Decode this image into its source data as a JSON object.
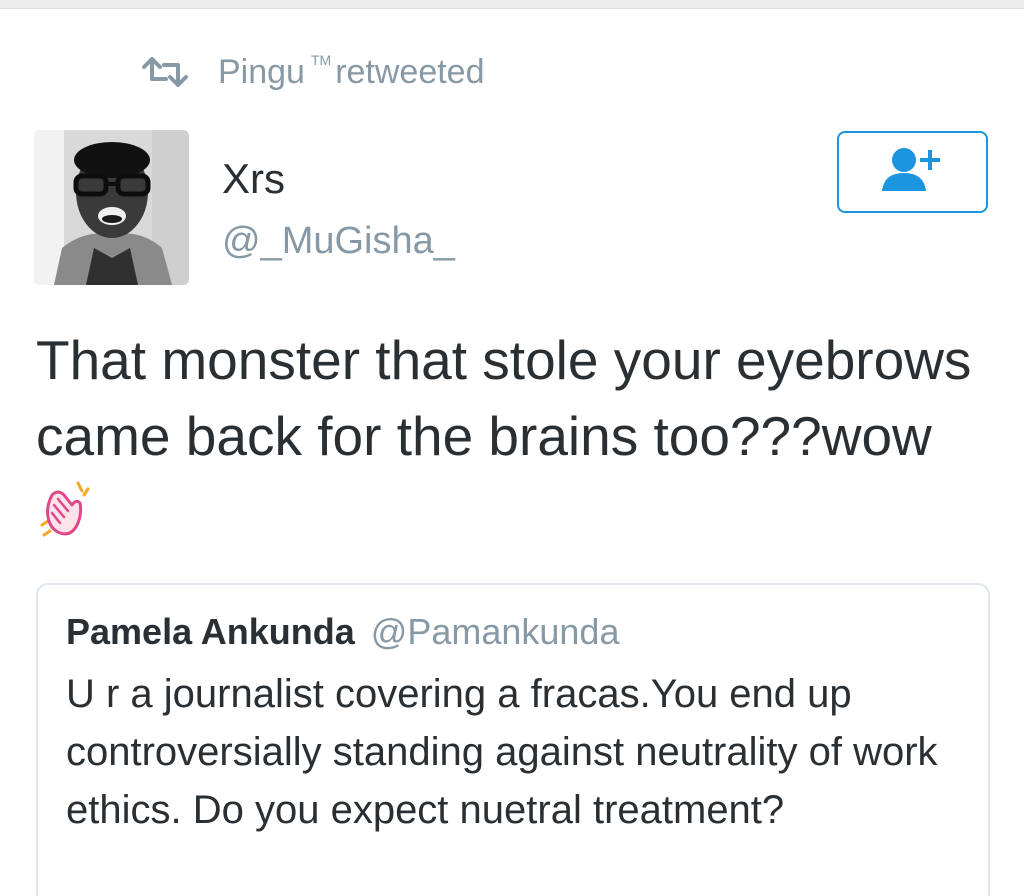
{
  "context": {
    "retweeter_name": "Pingu",
    "trademark": "TM",
    "action": "retweeted",
    "icon": "retweet-icon"
  },
  "tweet": {
    "user_name": "Xrs",
    "user_handle": "@_MuGisha_",
    "avatar": "user-avatar",
    "follow_icon": "follow-user-plus-icon",
    "text": "That monster that stole your eyebrows came back for the brains too???wow",
    "emoji": "clapping-hands-emoji"
  },
  "quote": {
    "name": "Pamela Ankunda",
    "handle": "@Pamankunda",
    "text": "U r a journalist covering a fracas.You end up controversially standing against neutrality of work ethics. Do you expect nuetral treatment?"
  },
  "colors": {
    "accent": "#1b95e0",
    "secondary_text": "#8899a6",
    "primary_text": "#292f33",
    "border": "#e1e8ed"
  }
}
